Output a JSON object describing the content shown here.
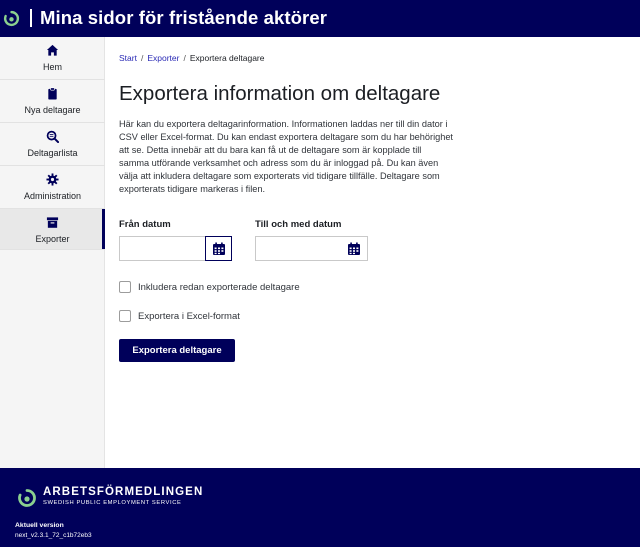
{
  "header": {
    "title": "Mina sidor för fristående aktörer",
    "logo_icon": "af-logo-icon"
  },
  "sidebar": {
    "items": [
      {
        "label": "Hem",
        "icon": "home-icon",
        "active": false
      },
      {
        "label": "Nya deltagare",
        "icon": "clipboard-icon",
        "active": false
      },
      {
        "label": "Deltagarlista",
        "icon": "search-list-icon",
        "active": false
      },
      {
        "label": "Administration",
        "icon": "gear-icon",
        "active": false
      },
      {
        "label": "Exporter",
        "icon": "archive-box-icon",
        "active": true
      }
    ]
  },
  "breadcrumb": {
    "items": [
      "Start",
      "Exporter",
      "Exportera deltagare"
    ],
    "separator": "/"
  },
  "main": {
    "title": "Exportera information om deltagare",
    "intro": "Här kan du exportera deltagarinformation. Informationen laddas ner till din dator i CSV eller Excel-format. Du kan endast exportera deltagare som du har behörighet att se. Detta innebär att du bara kan få ut de deltagare som är kopplade till samma utförande verksamhet och adress som du är inloggad på. Du kan även välja att inkludera deltagare som exporterats vid tidigare tillfälle. Deltagare som exporterats tidigare markeras i filen.",
    "from_date": {
      "label": "Från datum",
      "value": "",
      "placeholder": ""
    },
    "to_date": {
      "label": "Till och med datum",
      "value": "",
      "placeholder": ""
    },
    "options": [
      {
        "label": "Inkludera redan exporterade deltagare",
        "checked": false
      },
      {
        "label": "Exportera i Excel-format",
        "checked": false
      }
    ],
    "export_button": "Exportera deltagare"
  },
  "footer": {
    "brand": "ARBETSFÖRMEDLINGEN",
    "brand_sub": "SWEDISH PUBLIC EMPLOYMENT SERVICE",
    "version_label": "Aktuell version",
    "version_value": "next_v2.3.1_72_c1b72eb3"
  },
  "colors": {
    "primary": "#00005a",
    "logo_green": "#8bd08f",
    "link": "#2a2ab5"
  }
}
